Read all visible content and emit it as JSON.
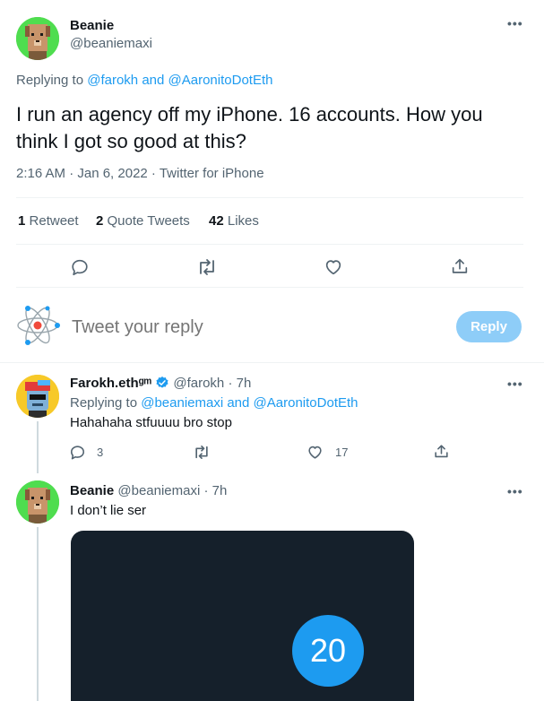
{
  "main_tweet": {
    "display_name": "Beanie",
    "handle": "@beaniemaxi",
    "replying_label": "Replying to",
    "replying_to_1": "@farokh",
    "replying_and": "and",
    "replying_to_2": "@AaronitoDotEth",
    "text": "I run an agency off my iPhone. 16 accounts. How you think I got so good at this?",
    "timestamp": "2:16 AM · Jan 6, 2022 · Twitter for iPhone",
    "stats": {
      "retweets_count": "1",
      "retweets_label": "Retweet",
      "quotes_count": "2",
      "quotes_label": "Quote Tweets",
      "likes_count": "42",
      "likes_label": "Likes"
    }
  },
  "composer": {
    "placeholder": "Tweet your reply",
    "button_label": "Reply"
  },
  "replies": [
    {
      "display_name": "Farokh.ethᵍᵐ",
      "handle": "@farokh",
      "age": "· 7h",
      "replying_label": "Replying to",
      "replying_to_1": "@beaniemaxi",
      "replying_and": "and",
      "replying_to_2": "@AaronitoDotEth",
      "text": "Hahahaha stfuuuu bro stop",
      "reply_count": "3",
      "retweet_count": "",
      "like_count": "17"
    },
    {
      "display_name": "Beanie",
      "handle": "@beaniemaxi",
      "age": "· 7h",
      "text": "I don’t lie ser",
      "media_badge": "20"
    }
  ],
  "colors": {
    "accent": "#1d9bf0",
    "reply_button_disabled": "#8ecdf8",
    "avatar_bg": "#4fdd4f",
    "media_bg": "#15202b"
  }
}
